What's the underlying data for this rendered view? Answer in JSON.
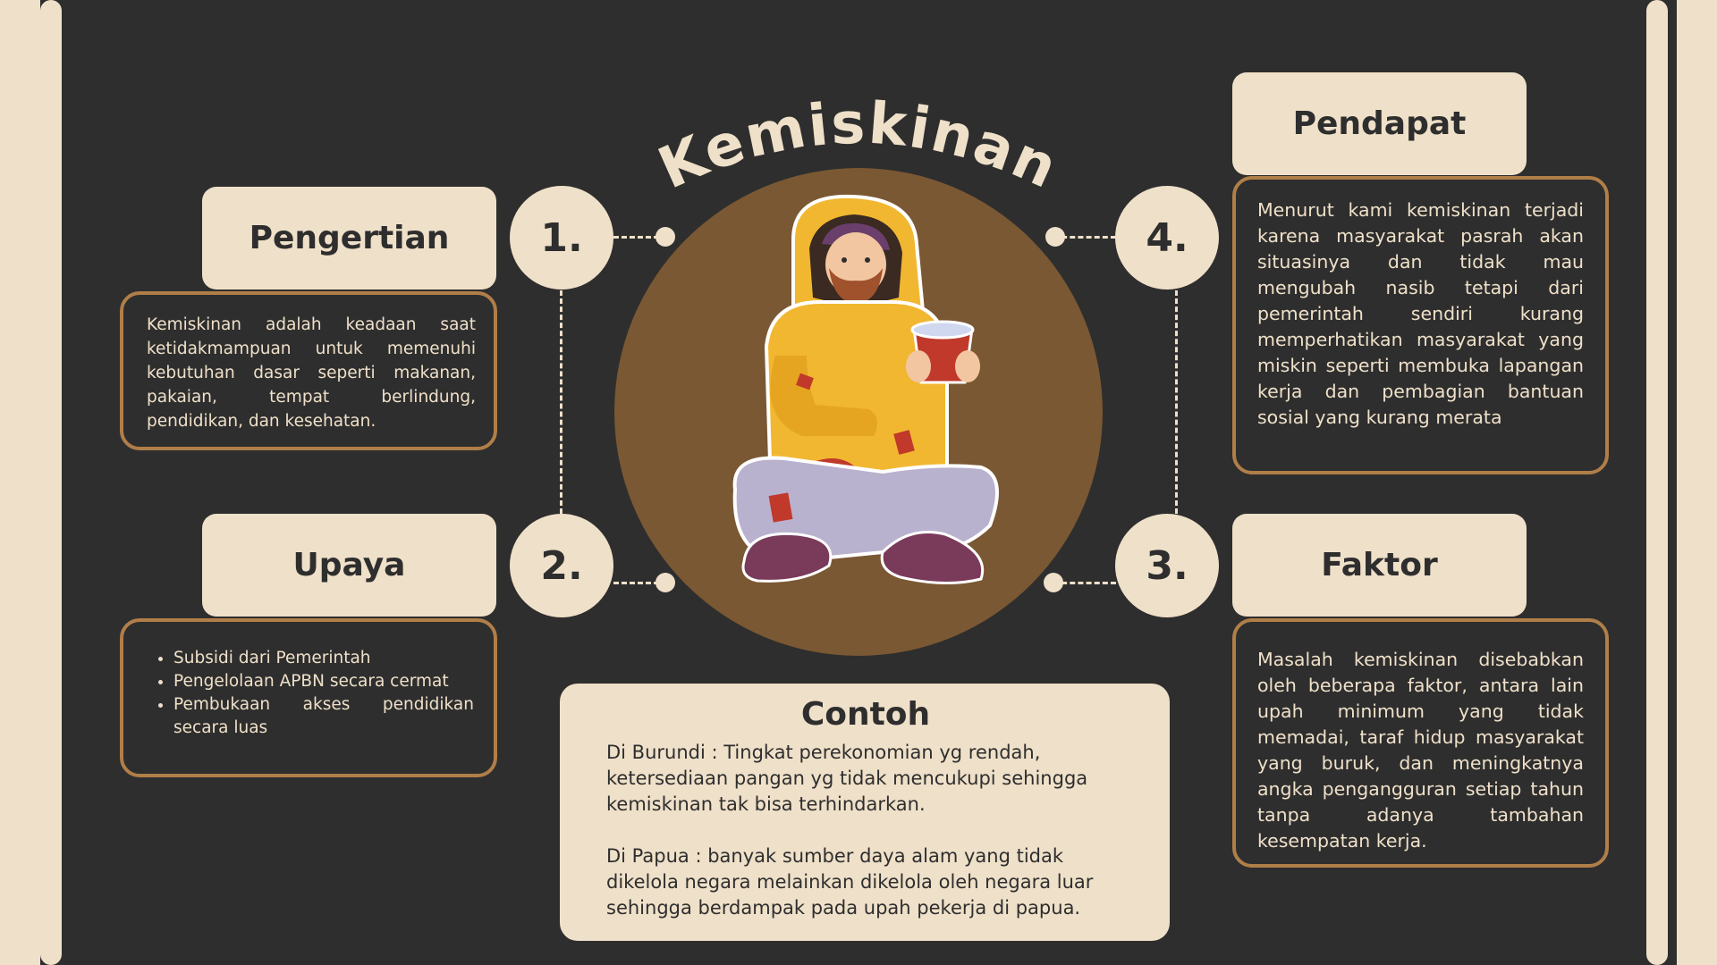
{
  "title": "Kemiskinan",
  "sections": {
    "pengertian": {
      "number": "1.",
      "label": "Pengertian",
      "text": "Kemiskinan adalah keadaan saat ketidakmampuan untuk memenuhi kebutuhan dasar seperti makanan, pakaian, tempat berlindung, pendidikan, dan kesehatan."
    },
    "upaya": {
      "number": "2.",
      "label": "Upaya",
      "items": [
        "Subsidi dari Pemerintah",
        "Pengelolaan APBN secara cermat",
        "Pembukaan akses pendidikan secara luas"
      ]
    },
    "faktor": {
      "number": "3.",
      "label": "Faktor",
      "text": "Masalah kemiskinan disebabkan oleh beberapa faktor, antara lain upah minimum yang tidak memadai, taraf hidup masyarakat yang buruk, dan meningkatnya angka pengangguran setiap tahun tanpa adanya tambahan kesempatan kerja."
    },
    "pendapat": {
      "number": "4.",
      "label": "Pendapat",
      "text": "Menurut kami kemiskinan terjadi karena masyarakat pasrah akan situasinya dan tidak mau mengubah nasib tetapi dari pemerintah sendiri kurang memperhatikan masyarakat yang miskin seperti membuka lapangan kerja dan pembagian bantuan sosial yang kurang merata"
    }
  },
  "contoh": {
    "label": "Contoh",
    "paragraph1": "Di Burundi : Tingkat perekonomian yg rendah, ketersediaan pangan yg tidak mencukupi sehingga kemiskinan tak bisa terhindarkan.",
    "paragraph2": "Di Papua : banyak sumber daya alam yang tidak dikelola negara melainkan dikelola oleh negara luar sehingga berdampak pada upah pekerja di papua."
  },
  "colors": {
    "background": "#2e2e2e",
    "cream": "#efe0c9",
    "brown": "#7a5833",
    "border": "#b07e48",
    "hoodie": "#f2b731"
  },
  "illustration": "poor-man-sitting-with-cup"
}
